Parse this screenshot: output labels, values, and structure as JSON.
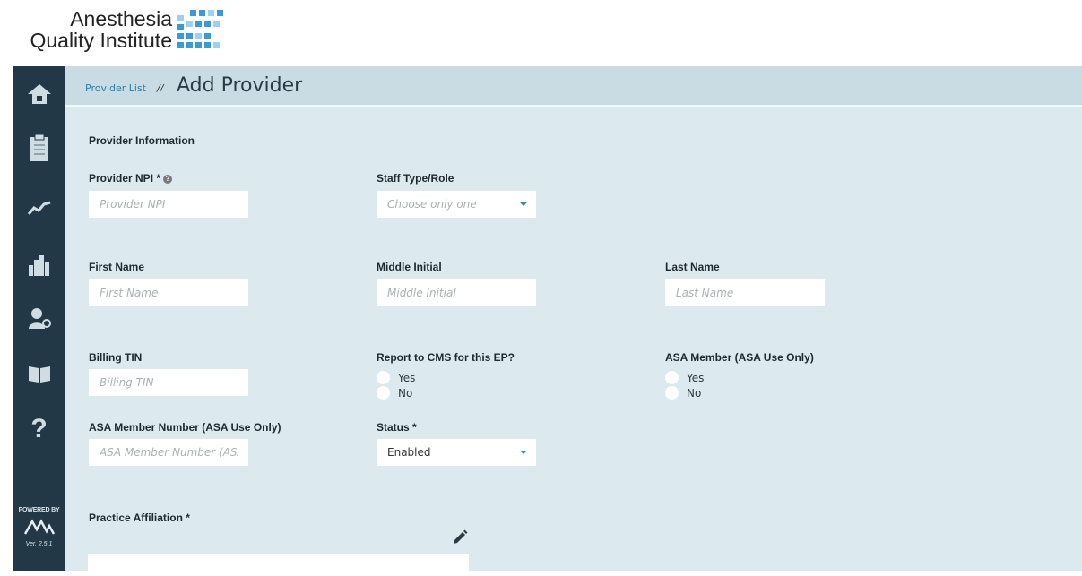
{
  "brand": {
    "line1": "Anesthesia",
    "line2": "Quality Institute"
  },
  "sidebar": {
    "items": [
      {
        "name": "home-icon"
      },
      {
        "name": "clipboard-icon"
      },
      {
        "name": "trend-line-icon"
      },
      {
        "name": "bar-chart-icon"
      },
      {
        "name": "user-settings-icon"
      },
      {
        "name": "book-icon"
      },
      {
        "name": "help-icon",
        "label": "?"
      }
    ],
    "powered_by": "POWERED BY",
    "version": "Ver. 2.5.1"
  },
  "breadcrumb": {
    "parent": "Provider List",
    "separator": "//",
    "current": "Add Provider"
  },
  "form": {
    "section_title": "Provider Information",
    "provider_npi": {
      "label": "Provider NPI *",
      "placeholder": "Provider NPI"
    },
    "staff_type": {
      "label": "Staff Type/Role",
      "value": "Choose only one"
    },
    "first_name": {
      "label": "First Name",
      "placeholder": "First Name"
    },
    "middle_initial": {
      "label": "Middle Initial",
      "placeholder": "Middle Initial"
    },
    "last_name": {
      "label": "Last Name",
      "placeholder": "Last Name"
    },
    "billing_tin": {
      "label": "Billing TIN",
      "placeholder": "Billing TIN"
    },
    "report_cms": {
      "label": "Report to CMS for this EP?",
      "yes": "Yes",
      "no": "No"
    },
    "asa_member": {
      "label": "ASA Member (ASA Use Only)",
      "yes": "Yes",
      "no": "No"
    },
    "asa_member_number": {
      "label": "ASA Member Number (ASA Use Only)",
      "placeholder": "ASA Member Number (ASA"
    },
    "status": {
      "label": "Status *",
      "value": "Enabled"
    },
    "practice_affiliation": {
      "label": "Practice Affiliation *"
    }
  },
  "colors": {
    "sidebar": "#233846",
    "main_bg": "#dce9ee",
    "topbar": "#c9dce3",
    "link": "#2a7fb0",
    "logo_blue": "#3a9ad9"
  }
}
